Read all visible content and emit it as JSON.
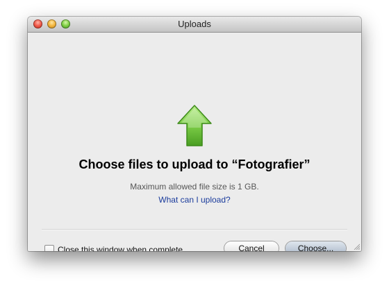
{
  "window": {
    "title": "Uploads"
  },
  "main": {
    "headline": "Choose files to upload to “Fotografier”",
    "max_size_text": "Maximum allowed file size is 1 GB.",
    "help_link": "What can I upload?"
  },
  "footer": {
    "checkbox_label": "Close this window when complete",
    "checkbox_checked": false,
    "cancel_label": "Cancel",
    "choose_label": "Choose..."
  },
  "icons": {
    "upload": "upload-arrow-icon",
    "close": "close-window-icon",
    "minimize": "minimize-window-icon",
    "zoom": "zoom-window-icon",
    "resize": "resize-grip-icon"
  },
  "colors": {
    "accent_green": "#6fbf3a",
    "link_blue": "#1a3b9c",
    "window_bg": "#ececec"
  }
}
